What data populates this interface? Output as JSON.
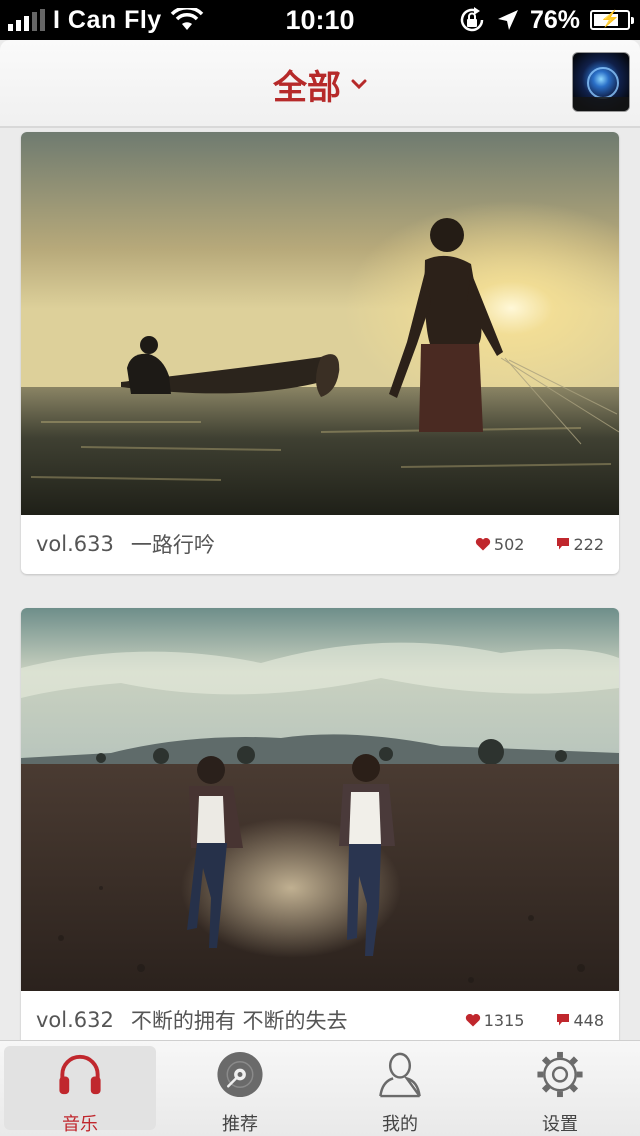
{
  "status_bar": {
    "carrier": "I Can Fly",
    "time": "10:10",
    "battery_percent": "76%",
    "battery_level": 0.76,
    "signal_bars": 3,
    "icons": [
      "signal-icon",
      "wifi-icon",
      "rotation-lock-icon",
      "location-icon",
      "battery-icon"
    ]
  },
  "nav": {
    "title": "全部",
    "title_icon": "chevron-down-icon",
    "thumbnail": "now-playing-thumbnail"
  },
  "colors": {
    "accent": "#c0272d",
    "background": "#ebebeb",
    "card": "#ffffff",
    "text": "#555555"
  },
  "cards": [
    {
      "vol": "vol.633",
      "title": "一路行吟",
      "likes": "502",
      "comments": "222",
      "photo": "fisherman-in-lake-at-sunset"
    },
    {
      "vol": "vol.632",
      "title": "不断的拥有 不断的失去",
      "likes": "1315",
      "comments": "448",
      "photo": "two-women-running-in-field"
    }
  ],
  "tabs": [
    {
      "label": "音乐",
      "icon": "headphones-icon",
      "active": true
    },
    {
      "label": "推荐",
      "icon": "disc-icon",
      "active": false
    },
    {
      "label": "我的",
      "icon": "person-icon",
      "active": false
    },
    {
      "label": "设置",
      "icon": "gear-icon",
      "active": false
    }
  ]
}
